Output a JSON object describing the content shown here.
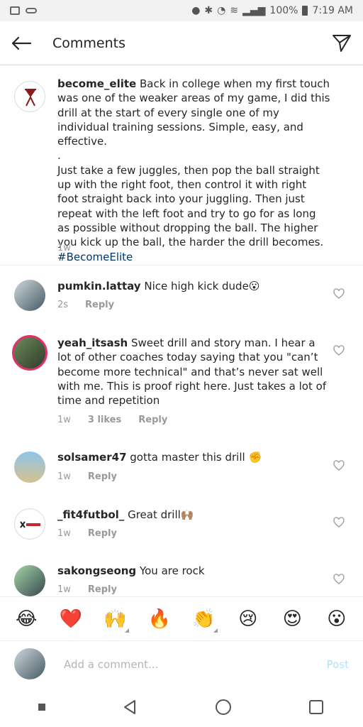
{
  "status_bar": {
    "battery": "100%",
    "time": "7:19 AM"
  },
  "header": {
    "title": "Comments"
  },
  "caption": {
    "username": "become_elite",
    "text_line1": " Back in college when my first touch was one of the weaker areas of my game, I did this drill at the start of every single one of my individual training sessions. Simple, easy, and effective.",
    "dot": ".",
    "text_line2": "Just take a few juggles, then pop the ball straight up with the right foot, then control it with right foot straight back into your juggling. Then just repeat with the left foot and try to go for as long as possible without dropping the ball. The higher you kick up the ball, the harder the drill becomes. ",
    "hashtag": "#BecomeElite",
    "time": "1w"
  },
  "comments": [
    {
      "username": "pumkin.lattay",
      "text": " Nice high kick dude😮",
      "time": "2s",
      "likes": "",
      "reply": "Reply"
    },
    {
      "username": "yeah_itsash",
      "text": " Sweet drill and story man. I hear a lot of other coaches today saying that you \"can’t become more technical\" and that’s never sat well with me. This is proof right here. Just takes a lot of time and repetition",
      "time": "1w",
      "likes": "3 likes",
      "reply": "Reply"
    },
    {
      "username": "solsamer47",
      "text": " gotta master this drill ✊",
      "time": "1w",
      "likes": "",
      "reply": "Reply"
    },
    {
      "username": "_fit4futbol_",
      "text": " Great drill🙌🏽",
      "time": "1w",
      "likes": "",
      "reply": "Reply"
    },
    {
      "username": "sakongseong",
      "text": " You are rock",
      "time": "1w",
      "likes": "",
      "reply": "Reply"
    }
  ],
  "emoji_bar": [
    "😂",
    "❤️",
    "🙌",
    "🔥",
    "👏",
    "😢",
    "😍",
    "😮"
  ],
  "input": {
    "placeholder": "Add a comment...",
    "post_label": "Post"
  }
}
